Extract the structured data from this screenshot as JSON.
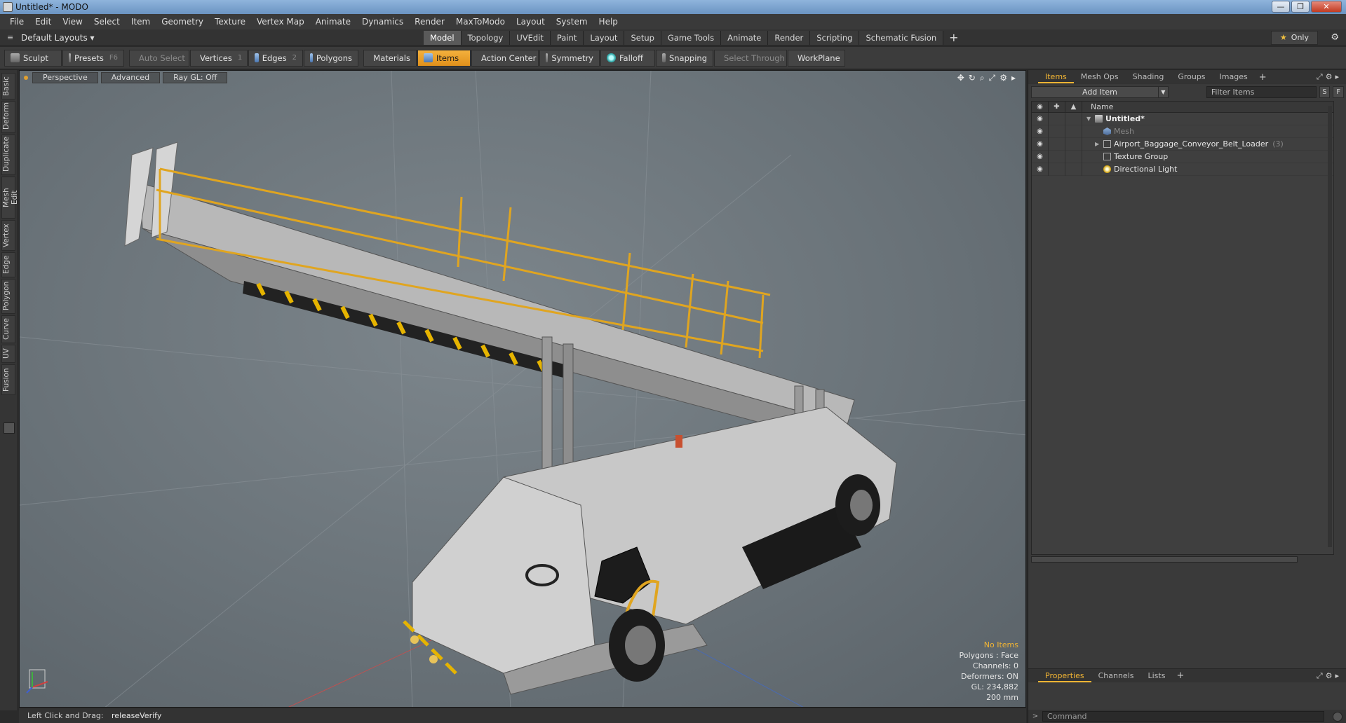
{
  "window": {
    "title": "Untitled* - MODO",
    "min": "—",
    "max": "❐",
    "close": "✕"
  },
  "menu": [
    "File",
    "Edit",
    "View",
    "Select",
    "Item",
    "Geometry",
    "Texture",
    "Vertex Map",
    "Animate",
    "Dynamics",
    "Render",
    "MaxToModo",
    "Layout",
    "System",
    "Help"
  ],
  "layout": {
    "selector": "Default Layouts ▾",
    "tabs": [
      "Model",
      "Topology",
      "UVEdit",
      "Paint",
      "Layout",
      "Setup",
      "Game Tools",
      "Animate",
      "Render",
      "Scripting",
      "Schematic Fusion"
    ],
    "active_tab": "Model",
    "add": "+",
    "only": "Only"
  },
  "toolbar": {
    "sculpt": "Sculpt",
    "presets": "Presets",
    "presets_key": "F6",
    "auto_select": "Auto Select",
    "vertices": "Vertices",
    "vertices_key": "1",
    "edges": "Edges",
    "edges_key": "2",
    "polygons": "Polygons",
    "materials": "Materials",
    "items": "Items",
    "action_center": "Action Center",
    "symmetry": "Symmetry",
    "falloff": "Falloff",
    "snapping": "Snapping",
    "select_through": "Select Through",
    "workplane": "WorkPlane"
  },
  "left_tabs": [
    "Basic",
    "Deform",
    "Duplicate",
    "Mesh Edit",
    "Vertex",
    "Edge",
    "Polygon",
    "Curve",
    "UV",
    "Fusion"
  ],
  "viewport": {
    "view": "Perspective",
    "shading": "Advanced",
    "raygl": "Ray GL: Off",
    "stats": {
      "items": "No Items",
      "polygons": "Polygons : Face",
      "channels": "Channels: 0",
      "deformers": "Deformers: ON",
      "gl": "GL: 234,882",
      "scale": "200 mm"
    }
  },
  "status": {
    "hint": "Left Click and Drag:",
    "command": "releaseVerify"
  },
  "right_panel": {
    "tabs": [
      "Items",
      "Mesh Ops",
      "Shading",
      "Groups",
      "Images"
    ],
    "active_tab": "Items",
    "add_item": "Add Item",
    "filter_placeholder": "Filter Items",
    "s_btn": "S",
    "f_btn": "F",
    "name_col": "Name",
    "tree": [
      {
        "label": "Untitled*",
        "count": ""
      },
      {
        "label": "Mesh",
        "count": ""
      },
      {
        "label": "Airport_Baggage_Conveyor_Belt_Loader",
        "count": "(3)"
      },
      {
        "label": "Texture Group",
        "count": ""
      },
      {
        "label": "Directional Light",
        "count": ""
      }
    ],
    "props_tabs": [
      "Properties",
      "Channels",
      "Lists"
    ],
    "command_placeholder": "Command"
  }
}
